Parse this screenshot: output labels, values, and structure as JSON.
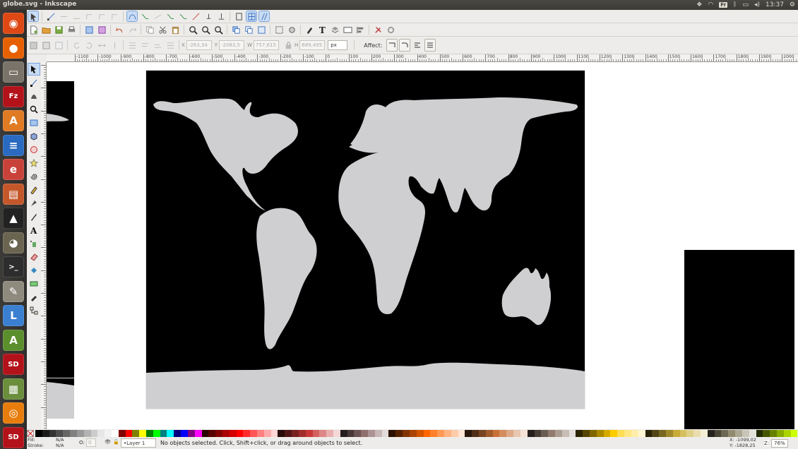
{
  "window": {
    "title": "globe.svg - Inkscape"
  },
  "tray": {
    "keyboard": "Fr",
    "time": "13:37"
  },
  "launcher": [
    {
      "name": "dash",
      "color": "#dd4814",
      "glyph": "◉"
    },
    {
      "name": "firefox",
      "color": "#e66000",
      "glyph": "●"
    },
    {
      "name": "files",
      "color": "#7a7369",
      "glyph": "▭"
    },
    {
      "name": "filezilla",
      "color": "#b3121a",
      "glyph": "Fz"
    },
    {
      "name": "software-center",
      "color": "#e07b24",
      "glyph": "A"
    },
    {
      "name": "libreoffice-writer",
      "color": "#2a6ac0",
      "glyph": "≡"
    },
    {
      "name": "evince",
      "color": "#c9423a",
      "glyph": "e"
    },
    {
      "name": "libreoffice-impress",
      "color": "#c4572a",
      "glyph": "▤"
    },
    {
      "name": "inkscape",
      "color": "#222222",
      "glyph": "▲"
    },
    {
      "name": "gimp",
      "color": "#6a6451",
      "glyph": "◕"
    },
    {
      "name": "terminal",
      "color": "#2d2d2d",
      "glyph": ">_"
    },
    {
      "name": "text-editor",
      "color": "#8e8a7e",
      "glyph": "✎"
    },
    {
      "name": "libreoffice",
      "color": "#3a7fd0",
      "glyph": "L"
    },
    {
      "name": "update-manager",
      "color": "#5b8f2e",
      "glyph": "A"
    },
    {
      "name": "sd-card",
      "color": "#b3121a",
      "glyph": "SD"
    },
    {
      "name": "image-viewer",
      "color": "#6b8e3d",
      "glyph": "▦"
    },
    {
      "name": "blender",
      "color": "#e87d0d",
      "glyph": "◎"
    },
    {
      "name": "sd-card-2",
      "color": "#b3121a",
      "glyph": "SD"
    }
  ],
  "selectbar": {
    "x_label": "X",
    "x_value": "-263,34",
    "y_label": "Y",
    "y_value": "-2083,5",
    "w_label": "W",
    "w_value": "757,615",
    "h_label": "H",
    "h_value": "689,495",
    "unit": "px",
    "affect_label": "Affect:"
  },
  "ruler_labels": [
    "-1100",
    "-1000",
    "-900",
    "-800",
    "-700",
    "-600",
    "-500",
    "-400",
    "-300",
    "-200",
    "-100",
    "0",
    "100",
    "200",
    "300",
    "400",
    "500",
    "600",
    "700",
    "800",
    "900",
    "1000",
    "1100",
    "1200",
    "1300",
    "1400",
    "1500",
    "1600",
    "1700",
    "1800",
    "1900",
    "2000",
    "2100"
  ],
  "status": {
    "fill_label": "Fill:",
    "fill_value": "N/A",
    "stroke_label": "Stroke:",
    "stroke_value": "N/A",
    "opacity_label": "O:",
    "opacity_value": "0",
    "layer": "•Layer 1",
    "message": "No objects selected. Click, Shift+click, or drag around objects to select.",
    "x_coord": "X: -1099,02",
    "y_coord": "Y: -1828,25",
    "zoom_label": "Z:",
    "zoom_value": "76%"
  },
  "palette": [
    "#000000",
    "#1a1a1a",
    "#333333",
    "#4d4d4d",
    "#666666",
    "#808080",
    "#999999",
    "#b3b3b3",
    "#cccccc",
    "#e6e6e6",
    "#f2f2f2",
    "#ffffff",
    "#800000",
    "#ff0000",
    "#808000",
    "#ffff00",
    "#008000",
    "#00ff00",
    "#008080",
    "#00ffff",
    "#000080",
    "#0000ff",
    "#800080",
    "#ff00ff",
    "#2b0000",
    "#550000",
    "#800000",
    "#aa0000",
    "#d40000",
    "#ff0000",
    "#ff2a2a",
    "#ff5555",
    "#ff8080",
    "#ffaaaa",
    "#ffd5d5",
    "#280b0b",
    "#501616",
    "#782121",
    "#a02c2c",
    "#c83737",
    "#d35f5f",
    "#de8787",
    "#e9afaf",
    "#f4d7d7",
    "#241c1c",
    "#483737",
    "#6c5353",
    "#916f6f",
    "#ac9393",
    "#c8b7b7",
    "#e3dbdb",
    "#2b1100",
    "#552200",
    "#803300",
    "#aa4400",
    "#d45500",
    "#ff6600",
    "#ff7f2a",
    "#ff9955",
    "#ffb380",
    "#ffccaa",
    "#ffe6d5",
    "#28170b",
    "#502d16",
    "#784421",
    "#a05a2c",
    "#c87137",
    "#d38d5f",
    "#deaa87",
    "#e9c6af",
    "#f4e3d7",
    "#241f1c",
    "#483e37",
    "#6c5d53",
    "#917c6f",
    "#ac9d93",
    "#c8beb7",
    "#e3dedb",
    "#2b2200",
    "#554400",
    "#806600",
    "#aa8800",
    "#d4aa00",
    "#ffcc00",
    "#ffdd55",
    "#ffe680",
    "#ffeeaa",
    "#fff6d5",
    "#28220b",
    "#504416",
    "#786721",
    "#a0892c",
    "#c8ab37",
    "#d4c05f",
    "#dfd087",
    "#e9ddaf",
    "#f4eed7",
    "#24221c",
    "#484537",
    "#6c6753",
    "#918a6f",
    "#aca793",
    "#c8c4b7",
    "#e3e2db",
    "#222b00",
    "#445500",
    "#668000",
    "#88aa00",
    "#aad400",
    "#ccff00"
  ]
}
